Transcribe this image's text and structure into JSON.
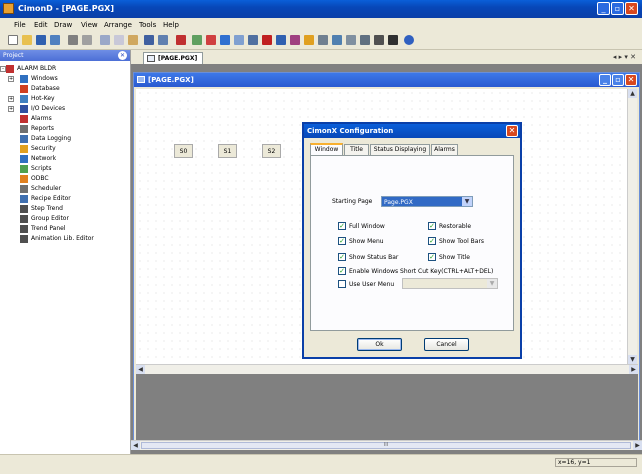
{
  "window": {
    "title": "CimonD - [PAGE.PGX]",
    "controls": [
      "_",
      "▫",
      "✕"
    ]
  },
  "menu": [
    "File",
    "Edit",
    "Draw",
    "View",
    "Arrange",
    "Tools",
    "Help"
  ],
  "project": {
    "header": "Project",
    "items": [
      {
        "label": "ALARM BLDR",
        "icon": "alarm-bell-icon",
        "color": "#c03030"
      },
      {
        "label": "Windows",
        "icon": "windows-icon",
        "color": "#3070c0"
      },
      {
        "label": "Database",
        "icon": "database-icon",
        "color": "#d04020"
      },
      {
        "label": "Hot-Key",
        "icon": "hotkey-icon",
        "color": "#4080c0"
      },
      {
        "label": "I/O Devices",
        "icon": "io-devices-icon",
        "color": "#3050a0"
      },
      {
        "label": "Alarms",
        "icon": "alarm-icon",
        "color": "#c03030"
      },
      {
        "label": "Reports",
        "icon": "reports-icon",
        "color": "#707070"
      },
      {
        "label": "Data Logging",
        "icon": "data-logging-icon",
        "color": "#4070b0"
      },
      {
        "label": "Security",
        "icon": "security-icon",
        "color": "#e0a020"
      },
      {
        "label": "Network",
        "icon": "network-icon",
        "color": "#3070c0"
      },
      {
        "label": "Scripts",
        "icon": "scripts-icon",
        "color": "#50a050"
      },
      {
        "label": "ODBC",
        "icon": "odbc-icon",
        "color": "#e08020"
      },
      {
        "label": "Scheduler",
        "icon": "scheduler-icon",
        "color": "#707070"
      },
      {
        "label": "Recipe Editor",
        "icon": "recipe-icon",
        "color": "#4070b0"
      },
      {
        "label": "Step Trend",
        "icon": "step-trend-icon",
        "color": "#505050"
      },
      {
        "label": "Group Editor",
        "icon": "group-editor-icon",
        "color": "#505050"
      },
      {
        "label": "Trend Panel",
        "icon": "trend-panel-icon",
        "color": "#505050"
      },
      {
        "label": "Animation Lib. Editor",
        "icon": "animation-lib-icon",
        "color": "#505050"
      }
    ]
  },
  "doc_tab": {
    "label": "[PAGE.PGX]",
    "controls": "◂ ▸ ▾ ✕"
  },
  "child_window": {
    "title": "[PAGE.PGX]"
  },
  "canvas_buttons": [
    "S0",
    "S1",
    "S2"
  ],
  "scroll_label": "III",
  "dialog": {
    "title": "CimonX Configuration",
    "tabs": [
      "Window",
      "Title",
      "Status Displaying",
      "Alarms"
    ],
    "starting_page_label": "Starting Page",
    "starting_page_value": "Page.PGX",
    "checks": {
      "full_window": {
        "label": "Full Window",
        "checked": true
      },
      "restorable": {
        "label": "Restorable",
        "checked": true
      },
      "show_menu": {
        "label": "Show Menu",
        "checked": true
      },
      "show_tool_bars": {
        "label": "Show Tool Bars",
        "checked": true
      },
      "show_status_bar": {
        "label": "Show Status Bar",
        "checked": true
      },
      "show_title": {
        "label": "Show Title",
        "checked": true
      },
      "enable_shortcut": {
        "label": "Enable Windows Short Cut Key(CTRL+ALT+DEL)",
        "checked": true
      },
      "use_user_menu": {
        "label": "Use User Menu",
        "checked": false
      }
    },
    "ok": "Ok",
    "cancel": "Cancel"
  },
  "status": {
    "coords": "x=16, y=1"
  }
}
